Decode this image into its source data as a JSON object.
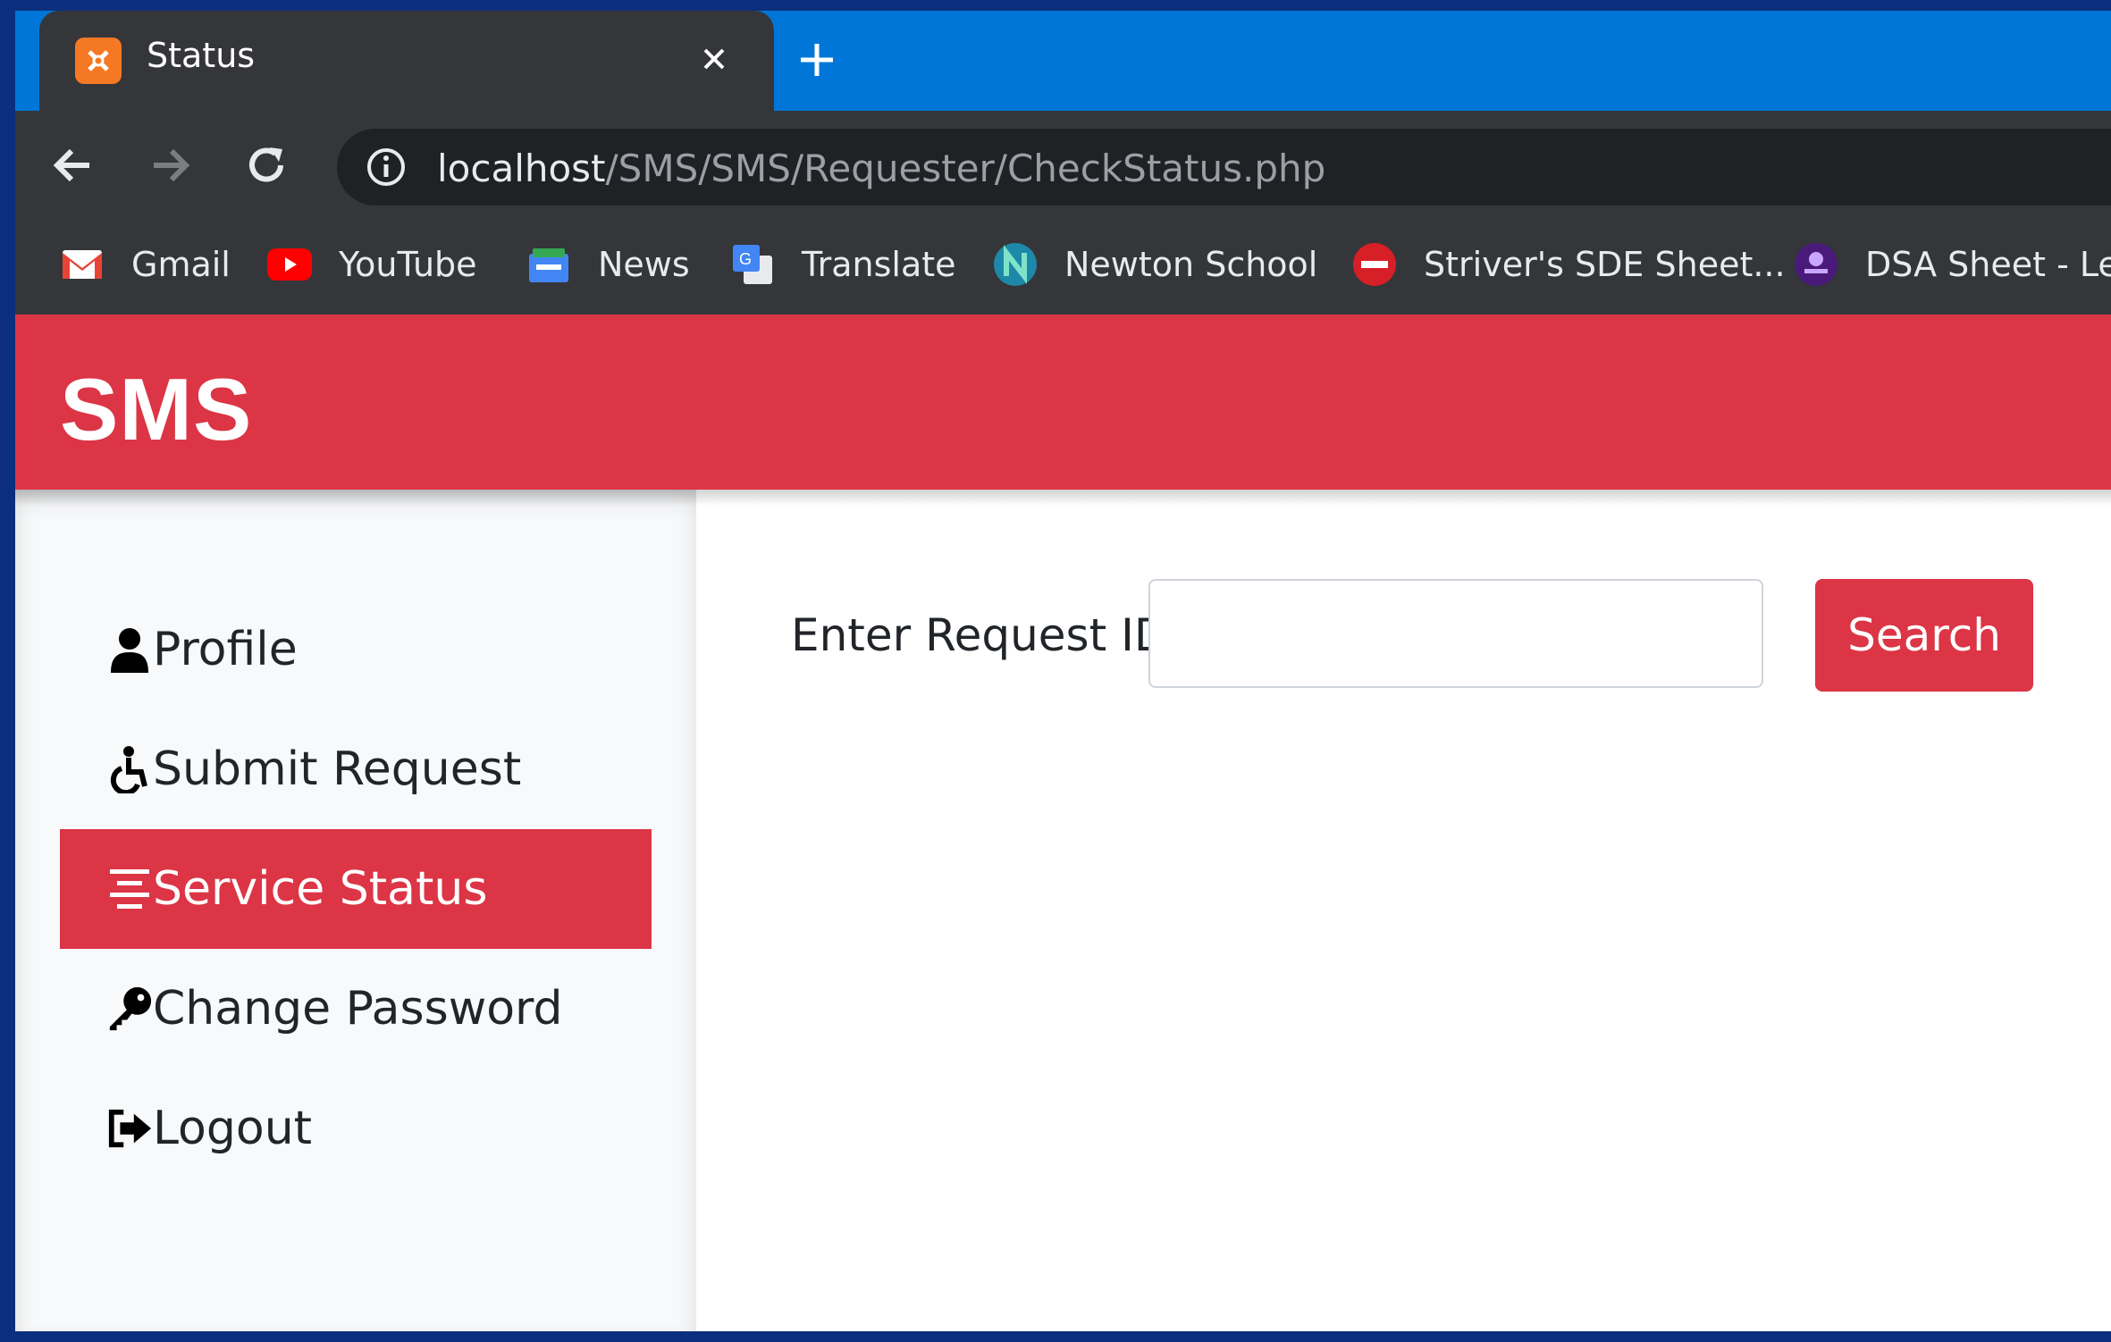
{
  "browser": {
    "tab": {
      "title": "Status",
      "favicon": "xampp-icon"
    },
    "address_bar": {
      "host": "localhost",
      "path": "/SMS/SMS/Requester/CheckStatus.php"
    },
    "bookmarks": [
      {
        "label": "Gmail",
        "icon": "gmail-icon"
      },
      {
        "label": "YouTube",
        "icon": "youtube-icon"
      },
      {
        "label": "News",
        "icon": "news-icon"
      },
      {
        "label": "Translate",
        "icon": "translate-icon"
      },
      {
        "label": "Newton School",
        "icon": "newton-school-icon"
      },
      {
        "label": "Striver's SDE Sheet...",
        "icon": "tuf-icon"
      },
      {
        "label": "DSA Sheet - Le",
        "icon": "dsa-sheet-icon"
      }
    ]
  },
  "app": {
    "brand": "SMS",
    "accent_color": "#dc3545",
    "sidebar": {
      "items": [
        {
          "label": "Profile",
          "icon": "user-icon",
          "active": false
        },
        {
          "label": "Submit Request",
          "icon": "accessibility-icon",
          "active": false
        },
        {
          "label": "Service Status",
          "icon": "align-center-icon",
          "active": true
        },
        {
          "label": "Change Password",
          "icon": "key-icon",
          "active": false
        },
        {
          "label": "Logout",
          "icon": "sign-out-icon",
          "active": false
        }
      ]
    },
    "form": {
      "label": "Enter Request ID:",
      "value": "",
      "search_label": "Search"
    }
  }
}
